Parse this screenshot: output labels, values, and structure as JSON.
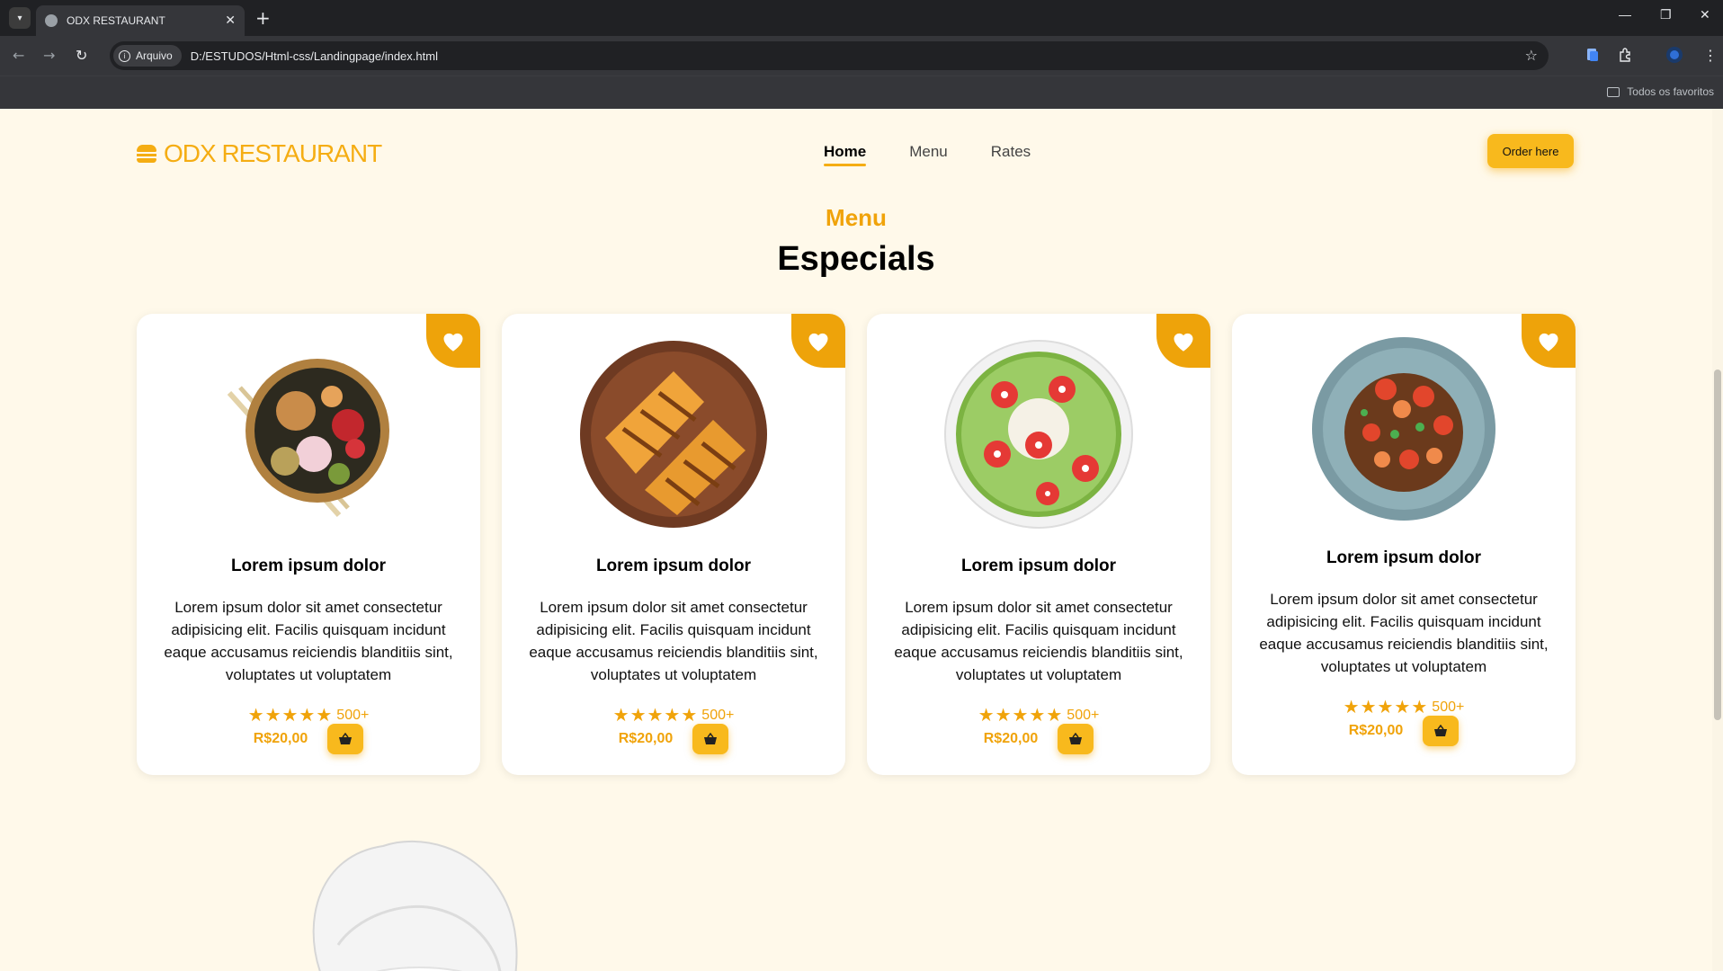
{
  "browser": {
    "tab_title": "ODX RESTAURANT",
    "security_chip": "Arquivo",
    "url": "D:/ESTUDOS/Html-css/Landingpage/index.html",
    "bookmarks_label": "Todos os favoritos"
  },
  "header": {
    "logo_text": "ODX RESTAURANT",
    "nav": [
      {
        "label": "Home",
        "active": true
      },
      {
        "label": "Menu",
        "active": false
      },
      {
        "label": "Rates",
        "active": false
      }
    ],
    "order_button": "Order here"
  },
  "section": {
    "subtitle": "Menu",
    "title": "Especials"
  },
  "cards": [
    {
      "dish_icon": "rice-bowl-with-chopsticks",
      "title": "Lorem ipsum dolor",
      "description": "Lorem ipsum dolor sit amet consectetur adipisicing elit. Facilis quisquam incidunt eaque accusamus reiciendis blanditiis sint, voluptates ut voluptatem",
      "stars": 5,
      "rating_count": "500+",
      "price": "R$20,00"
    },
    {
      "dish_icon": "grilled-sandwich",
      "title": "Lorem ipsum dolor",
      "description": "Lorem ipsum dolor sit amet consectetur adipisicing elit. Facilis quisquam incidunt eaque accusamus reiciendis blanditiis sint, voluptates ut voluptatem",
      "stars": 5,
      "rating_count": "500+",
      "price": "R$20,00"
    },
    {
      "dish_icon": "kiwi-strawberry-bowl",
      "title": "Lorem ipsum dolor",
      "description": "Lorem ipsum dolor sit amet consectetur adipisicing elit. Facilis quisquam incidunt eaque accusamus reiciendis blanditiis sint, voluptates ut voluptatem",
      "stars": 5,
      "rating_count": "500+",
      "price": "R$20,00"
    },
    {
      "dish_icon": "shrimp-noodles-plate",
      "title": "Lorem ipsum dolor",
      "description": "Lorem ipsum dolor sit amet consectetur adipisicing elit. Facilis quisquam incidunt eaque accusamus reiciendis blanditiis sint, voluptates ut voluptatem",
      "stars": 5,
      "rating_count": "500+",
      "price": "R$20,00"
    }
  ],
  "colors": {
    "accent": "#f5ad13",
    "page_bg": "#fff9ea",
    "card_bg": "#ffffff"
  }
}
